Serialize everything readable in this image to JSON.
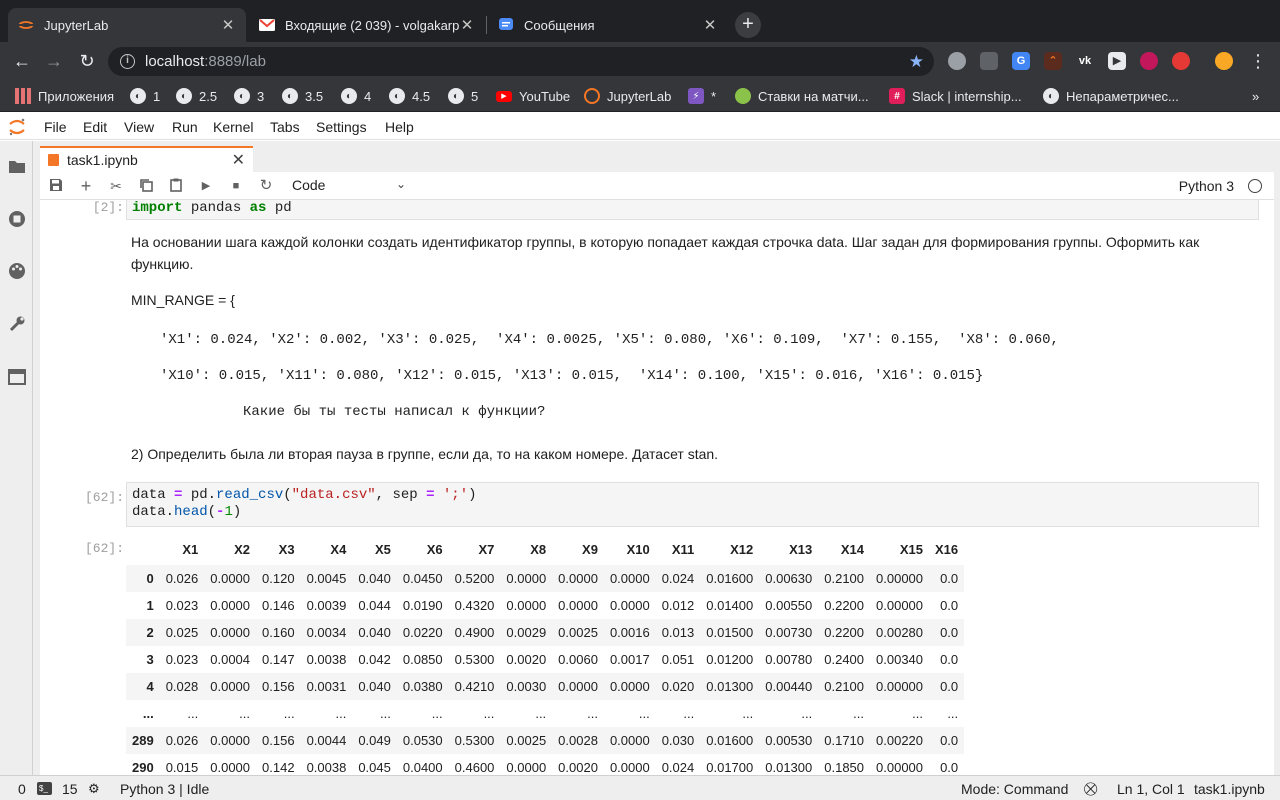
{
  "browser": {
    "tabs": [
      {
        "title": "JupyterLab",
        "active": true
      },
      {
        "title": "Входящие (2 039) - volgakarp",
        "active": false
      },
      {
        "title": "Сообщения",
        "active": false
      }
    ],
    "new_tab_label": "+",
    "address": {
      "host": "localhost",
      "rest": ":8889/lab"
    },
    "bookmarks": [
      {
        "label": "Приложения",
        "icon": "apps-grid-icon"
      },
      {
        "label": "1",
        "icon": "globe-icon"
      },
      {
        "label": "2.5",
        "icon": "globe-icon"
      },
      {
        "label": "3",
        "icon": "globe-icon"
      },
      {
        "label": "3.5",
        "icon": "globe-icon"
      },
      {
        "label": "4",
        "icon": "globe-icon"
      },
      {
        "label": "4.5",
        "icon": "globe-icon"
      },
      {
        "label": "5",
        "icon": "globe-icon"
      },
      {
        "label": "YouTube",
        "icon": "youtube-icon"
      },
      {
        "label": "JupyterLab",
        "icon": "jupyter-icon"
      },
      {
        "label": "*",
        "icon": "bolt-icon"
      },
      {
        "label": "Ставки на матчи...",
        "icon": "ball-icon"
      },
      {
        "label": "Slack | internship...",
        "icon": "slack-icon"
      },
      {
        "label": "Непараметричес...",
        "icon": "globe-icon"
      }
    ],
    "bookmarks_overflow": "»"
  },
  "jupyter": {
    "menu": [
      "File",
      "Edit",
      "View",
      "Run",
      "Kernel",
      "Tabs",
      "Settings",
      "Help"
    ],
    "doc_tab": "task1.ipynb",
    "cell_type": "Code",
    "kernel": "Python 3"
  },
  "cells": {
    "c2_prompt": "[2]:",
    "c2_code": {
      "kw1": "import",
      "mod": " pandas ",
      "kw2": "as",
      "alias": " pd"
    },
    "md1": "На основании шага каждой колонки создать идентификатор группы, в которую попадает каждая строчка data. Шаг задан для формирования группы. Оформить как функцию.",
    "md_min_range": "MIN_RANGE = {",
    "md_line1": "'X1': 0.024, 'X2': 0.002, 'X3': 0.025,  'X4': 0.0025, 'X5': 0.080, 'X6': 0.109,  'X7': 0.155,  'X8': 0.060,",
    "md_line2": "'X10': 0.015, 'X11': 0.080, 'X12': 0.015, 'X13': 0.015,  'X14': 0.100, 'X15': 0.016, 'X16': 0.015}",
    "md_question": "Какие бы ты тесты написал к функции?",
    "md2": "2) Определить была ли вторая пауза в группе, если да, то на каком номере. Датасет stan.",
    "c62_prompt": "[62]:",
    "c62_code1": {
      "a": "data ",
      "eq": "=",
      "b": " pd.",
      "fn": "read_csv",
      "c": "(",
      "s1": "\"data.csv\"",
      "d": ", sep ",
      "eq2": "=",
      "e": " ",
      "s2": "';'",
      "f": ")"
    },
    "c62_code2": {
      "a": "data.",
      "fn": "head",
      "b": "(",
      "op": "-",
      "n": "1",
      "c": ")"
    },
    "out62_prompt": "[62]:"
  },
  "dataframe": {
    "columns": [
      "",
      "X1",
      "X2",
      "X3",
      "X4",
      "X5",
      "X6",
      "X7",
      "X8",
      "X9",
      "X10",
      "X11",
      "X12",
      "X13",
      "X14",
      "X15",
      "X16"
    ],
    "rows": [
      [
        "0",
        "0.026",
        "0.0000",
        "0.120",
        "0.0045",
        "0.040",
        "0.0450",
        "0.5200",
        "0.0000",
        "0.0000",
        "0.0000",
        "0.024",
        "0.01600",
        "0.00630",
        "0.2100",
        "0.00000",
        "0.0"
      ],
      [
        "1",
        "0.023",
        "0.0000",
        "0.146",
        "0.0039",
        "0.044",
        "0.0190",
        "0.4320",
        "0.0000",
        "0.0000",
        "0.0000",
        "0.012",
        "0.01400",
        "0.00550",
        "0.2200",
        "0.00000",
        "0.0"
      ],
      [
        "2",
        "0.025",
        "0.0000",
        "0.160",
        "0.0034",
        "0.040",
        "0.0220",
        "0.4900",
        "0.0029",
        "0.0025",
        "0.0016",
        "0.013",
        "0.01500",
        "0.00730",
        "0.2200",
        "0.00280",
        "0.0"
      ],
      [
        "3",
        "0.023",
        "0.0004",
        "0.147",
        "0.0038",
        "0.042",
        "0.0850",
        "0.5300",
        "0.0020",
        "0.0060",
        "0.0017",
        "0.051",
        "0.01200",
        "0.00780",
        "0.2400",
        "0.00340",
        "0.0"
      ],
      [
        "4",
        "0.028",
        "0.0000",
        "0.156",
        "0.0031",
        "0.040",
        "0.0380",
        "0.4210",
        "0.0030",
        "0.0000",
        "0.0000",
        "0.020",
        "0.01300",
        "0.00440",
        "0.2100",
        "0.00000",
        "0.0"
      ],
      [
        "...",
        "...",
        "...",
        "...",
        "...",
        "...",
        "...",
        "...",
        "...",
        "...",
        "...",
        "...",
        "...",
        "...",
        "...",
        "...",
        "..."
      ],
      [
        "289",
        "0.026",
        "0.0000",
        "0.156",
        "0.0044",
        "0.049",
        "0.0530",
        "0.5300",
        "0.0025",
        "0.0028",
        "0.0000",
        "0.030",
        "0.01600",
        "0.00530",
        "0.1710",
        "0.00220",
        "0.0"
      ],
      [
        "290",
        "0.015",
        "0.0000",
        "0.142",
        "0.0038",
        "0.045",
        "0.0400",
        "0.4600",
        "0.0000",
        "0.0020",
        "0.0000",
        "0.024",
        "0.01700",
        "0.01300",
        "0.1850",
        "0.00000",
        "0.0"
      ]
    ]
  },
  "status": {
    "count1": "0",
    "count2": "15",
    "kernel_state": "Python 3 | Idle",
    "mode": "Mode: Command",
    "position": "Ln 1, Col 1",
    "file": "task1.ipynb"
  }
}
